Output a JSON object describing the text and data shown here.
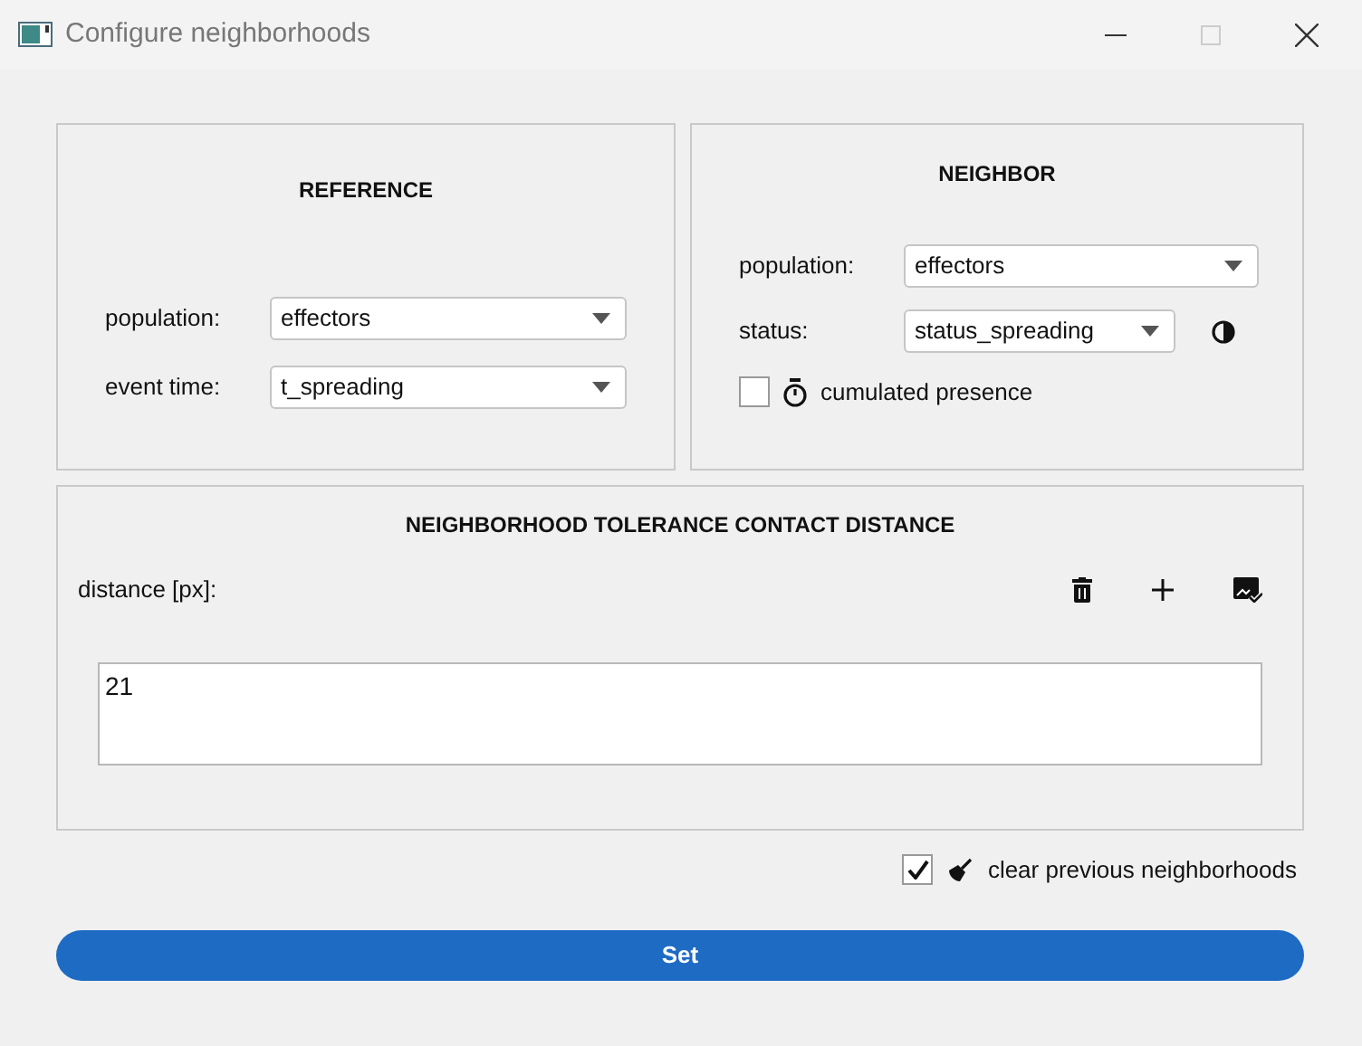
{
  "window": {
    "title": "Configure neighborhoods"
  },
  "reference": {
    "title": "REFERENCE",
    "fields": [
      {
        "label": "population:",
        "value": "effectors"
      },
      {
        "label": "event time:",
        "value": "t_spreading"
      }
    ]
  },
  "neighbor": {
    "title": "NEIGHBOR",
    "fields": [
      {
        "label": "population:",
        "value": "effectors",
        "kind": "select"
      },
      {
        "label": "status:",
        "value": "status_spreading",
        "kind": "select-with-toggle"
      }
    ],
    "cumulated": {
      "label": "cumulated presence",
      "checked": false
    }
  },
  "distance": {
    "title": "NEIGHBORHOOD TOLERANCE CONTACT DISTANCE",
    "label": "distance [px]:",
    "items": [
      "21"
    ]
  },
  "clear": {
    "label": "clear previous neighborhoods",
    "checked": true
  },
  "set_button": "Set"
}
